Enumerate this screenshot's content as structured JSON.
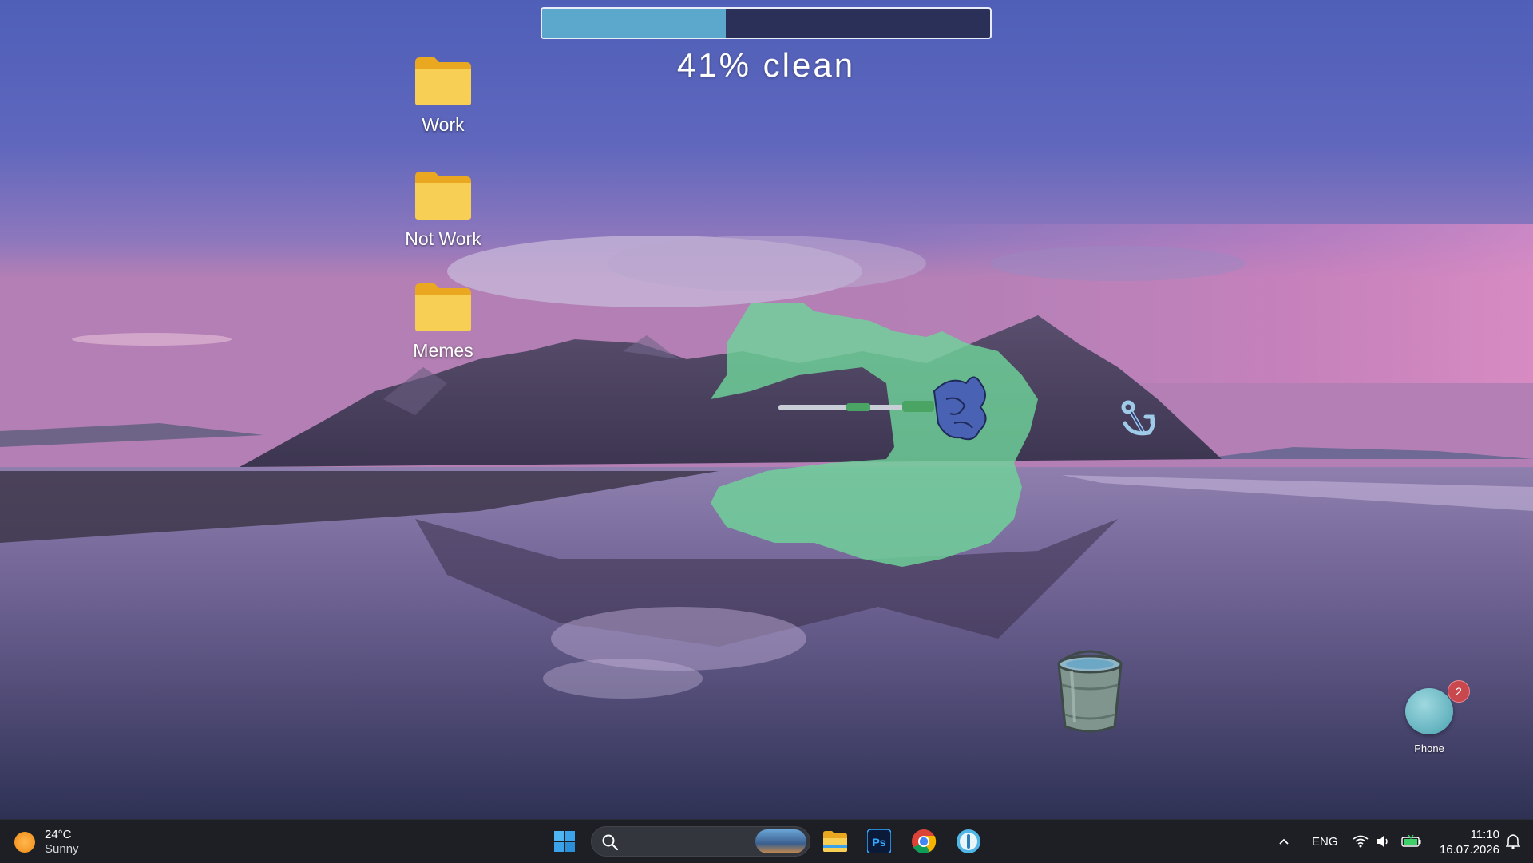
{
  "game": {
    "progress_percent": 41,
    "progress_label": "41% clean"
  },
  "desktop": {
    "icons": [
      {
        "label": "Work"
      },
      {
        "label": "Not Work"
      },
      {
        "label": "Memes"
      }
    ],
    "phone": {
      "label": "Phone",
      "badge": "2"
    }
  },
  "taskbar": {
    "weather": {
      "temp": "24°C",
      "condition": "Sunny"
    },
    "apps": [
      "start-icon",
      "search-icon",
      "file-explorer-icon",
      "photoshop-icon",
      "chrome-icon",
      "app-icon"
    ],
    "tray": {
      "language": "ENG",
      "time": "11:10",
      "date": "16.07.2026"
    }
  },
  "colors": {
    "progress_fill": "#5ca7cc",
    "progress_bg": "#2b3058",
    "slime": "#6fd39a",
    "folder": "#f6c84a"
  }
}
